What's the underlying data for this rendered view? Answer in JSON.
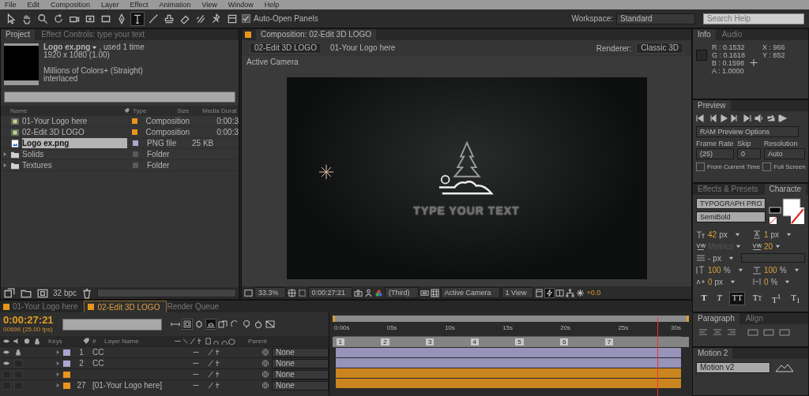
{
  "menu": [
    "File",
    "Edit",
    "Composition",
    "Layer",
    "Effect",
    "Animation",
    "View",
    "Window",
    "Help"
  ],
  "toolbar": {
    "tools": [
      {
        "kind": "select",
        "selected": false
      },
      {
        "kind": "hand",
        "selected": false
      },
      {
        "kind": "zoom",
        "selected": false
      },
      {
        "kind": "rotate",
        "selected": false
      },
      {
        "kind": "camera",
        "selected": false
      },
      {
        "kind": "pan",
        "selected": false
      },
      {
        "kind": "rect",
        "selected": false
      },
      {
        "kind": "pen",
        "selected": false
      },
      {
        "kind": "text",
        "selected": true
      },
      {
        "kind": "brush",
        "selected": false
      },
      {
        "kind": "stamp",
        "selected": false
      },
      {
        "kind": "eraser",
        "selected": false
      },
      {
        "kind": "roto",
        "selected": false
      },
      {
        "kind": "pin",
        "selected": false
      }
    ],
    "auto_open": {
      "label": "Auto-Open Panels",
      "checked": true
    },
    "workspace_label": "Workspace:",
    "workspace": "Standard",
    "search_placeholder": "Search Help"
  },
  "project": {
    "tabs": [
      {
        "label": "Project",
        "selected": true
      },
      {
        "label": "Effect Controls: type your text",
        "selected": false
      }
    ],
    "preview": {
      "name": "Logo ex.png",
      "usage": ", used 1 time",
      "dimensions": "1920 x 1080 (1.00)",
      "colors": "Millions of Colors+ (Straight)",
      "field": "interlaced"
    },
    "columns": [
      "Name",
      "Type",
      "Size",
      "Media Durat"
    ],
    "items": [
      {
        "kind": "comp",
        "name": "01-Your Logo here",
        "type": "Composition",
        "duration": "0:00:3",
        "color": "#e8951c",
        "selected": false
      },
      {
        "kind": "comp",
        "name": "02-Edit 3D LOGO",
        "type": "Composition",
        "duration": "0:00:3",
        "color": "#e8951c",
        "selected": false
      },
      {
        "kind": "image",
        "name": "Logo ex.png",
        "type": "PNG file",
        "size": "25 KB",
        "color": "#aaa6d2",
        "selected": true
      },
      {
        "kind": "folder",
        "name": "Solids",
        "type": "Folder",
        "color": "#595959",
        "selected": false
      },
      {
        "kind": "folder",
        "name": "Textures",
        "type": "Folder",
        "color": "#595959",
        "selected": false
      }
    ],
    "bpc": "32 bpc"
  },
  "composition": {
    "tab": "Composition: 02-Edit 3D LOGO",
    "nav": [
      {
        "label": "02-Edit 3D LOGO",
        "selected": true
      },
      {
        "label": "01-Your Logo here",
        "selected": false
      }
    ],
    "renderer_label": "Renderer:",
    "renderer": "Classic 3D",
    "view_label": "Active Camera",
    "frame_text": "TYPE YOUR TEXT",
    "footer": {
      "zoom": "33.3%",
      "timecode": "0:00:27:21",
      "resolution": "(Third)",
      "camera": "Active Camera",
      "views": "1 View",
      "exposure": "+0.0"
    }
  },
  "info": {
    "tabs": [
      {
        "label": "Info",
        "selected": true
      },
      {
        "label": "Audio",
        "selected": false
      }
    ],
    "channels": [
      "R : 0.1532",
      "G : 0.1618",
      "B : 0.1598",
      "A : 1.0000"
    ],
    "coords": [
      "X : 966",
      "Y : 852"
    ]
  },
  "preview": {
    "tab": "Preview",
    "options": "RAM Preview Options",
    "frame_rate_label": "Frame Rate",
    "skip_label": "Skip",
    "resolution_label": "Resolution",
    "frame_rate": "(25)",
    "skip": "0",
    "resolution": "Auto",
    "checks": [
      {
        "label": "From Current Time",
        "checked": false
      },
      {
        "label": "Full Screen",
        "checked": false
      }
    ]
  },
  "character": {
    "tabs": [
      {
        "label": "Effects & Presets",
        "selected": false
      },
      {
        "label": "Characte",
        "selected": true
      }
    ],
    "font": "TYPOGRAPH PRO",
    "style": "SemiBold",
    "metrics": [
      {
        "kind": "size",
        "value": "42",
        "unit": "px",
        "disabled": false
      },
      {
        "kind": "leading",
        "value": "1",
        "unit": "px",
        "disabled": false
      },
      {
        "kind": "kerning",
        "value": "Metrics",
        "disabled": true
      },
      {
        "kind": "tracking",
        "value": "20",
        "disabled": false
      },
      {
        "kind": "stroke",
        "value": "-",
        "unit": "px",
        "disabled": false
      },
      {
        "kind": "vscale",
        "value": "100",
        "unit": "%",
        "disabled": false
      },
      {
        "kind": "hscale",
        "value": "100",
        "unit": "%",
        "disabled": false
      },
      {
        "kind": "baseline",
        "value": "0",
        "unit": "px",
        "disabled": false
      },
      {
        "kind": "tsume",
        "value": "0",
        "unit": "%",
        "disabled": false
      }
    ],
    "styles": [
      {
        "kind": "bold",
        "label": "T",
        "selected": false
      },
      {
        "kind": "italic",
        "label": "T",
        "selected": false
      },
      {
        "kind": "caps",
        "label": "TT",
        "selected": true
      },
      {
        "kind": "smallcaps",
        "label": "Tт",
        "selected": false
      },
      {
        "kind": "plain",
        "label": "T$^{1}$",
        "selected": false
      },
      {
        "kind": "plain",
        "label": "T$_{1}$",
        "selected": false
      }
    ]
  },
  "paragraph": {
    "tabs": [
      {
        "label": "Paragraph",
        "selected": true
      },
      {
        "label": "Align",
        "selected": false
      }
    ]
  },
  "motion": {
    "tab": "Motion 2",
    "preset": "Motion v2"
  },
  "timeline": {
    "tabs": [
      {
        "kind": "comp",
        "label": "01-Your Logo here",
        "selected": false
      },
      {
        "kind": "comp",
        "label": "02-Edit 3D LOGO",
        "selected": true
      },
      {
        "kind": "queue",
        "label": "Render Queue",
        "selected": false
      }
    ],
    "timecode": "0:00:27:21",
    "frame_info": "00696 (25.00 fps)",
    "columns": {
      "keys": "Keys",
      "number": "#",
      "layer_name": "Layer Name",
      "parent": "Parent"
    },
    "ruler": [
      "0:00s",
      "05s",
      "10s",
      "15s",
      "20s",
      "25s",
      "30s"
    ],
    "markers": [
      "1",
      "2",
      "3",
      "4",
      "5",
      "6",
      "7"
    ],
    "playhead": {
      "level": 0.905
    },
    "layers": [
      {
        "number": "1",
        "name": "CC",
        "color": "#aaa6d2",
        "visible": true,
        "locked": true,
        "parent": "None"
      },
      {
        "number": "2",
        "name": "CC",
        "color": "#aaa6d2",
        "visible": true,
        "locked": false,
        "parent": "None"
      },
      {
        "color": "#e8951c",
        "visible": false,
        "locked": false,
        "parent": "None"
      },
      {
        "number": "27",
        "name": "[01-Your Logo here]",
        "color": "#e8951c",
        "visible": false,
        "locked": false,
        "parent": "None"
      }
    ]
  }
}
